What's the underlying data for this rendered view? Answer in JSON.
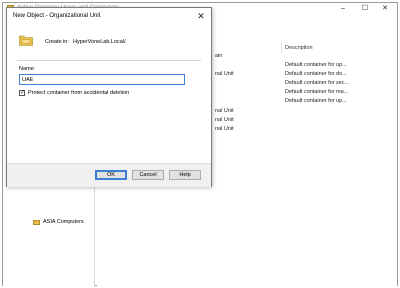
{
  "background_window": {
    "title": "Active Directory Users and Computers",
    "controls": {
      "minimize": "–",
      "maximize": "☐",
      "close": "✕"
    },
    "tree": {
      "asia_item": "ASIA Computers"
    },
    "list": {
      "col_name": "",
      "col_description": "Description",
      "header_fragment": "ain",
      "rows": [
        {
          "type": "",
          "description": "Default container for up..."
        },
        {
          "type": "nal Unit",
          "description": "Default container for do..."
        },
        {
          "type": "",
          "description": "Default container for sec..."
        },
        {
          "type": "",
          "description": "Default container for ma..."
        },
        {
          "type": "",
          "description": "Default container for up..."
        },
        {
          "type": "nal Unit",
          "description": ""
        },
        {
          "type": "nal Unit",
          "description": ""
        },
        {
          "type": "nal Unit",
          "description": ""
        }
      ]
    }
  },
  "dialog": {
    "title": "New Object - Organizational Unit",
    "close_glyph": "✕",
    "create_in_label": "Create in:",
    "create_in_value": "HyperVoneLab.Local/",
    "name_label": "Name:",
    "name_value": "UAE",
    "protect_checked_glyph": "✓",
    "protect_label": "Protect container from accidental deletion",
    "buttons": {
      "ok": "OK",
      "cancel": "Cancel",
      "help": "Help"
    }
  },
  "colors": {
    "accent": "#3c7fd4",
    "folder": "#e8c04a"
  }
}
